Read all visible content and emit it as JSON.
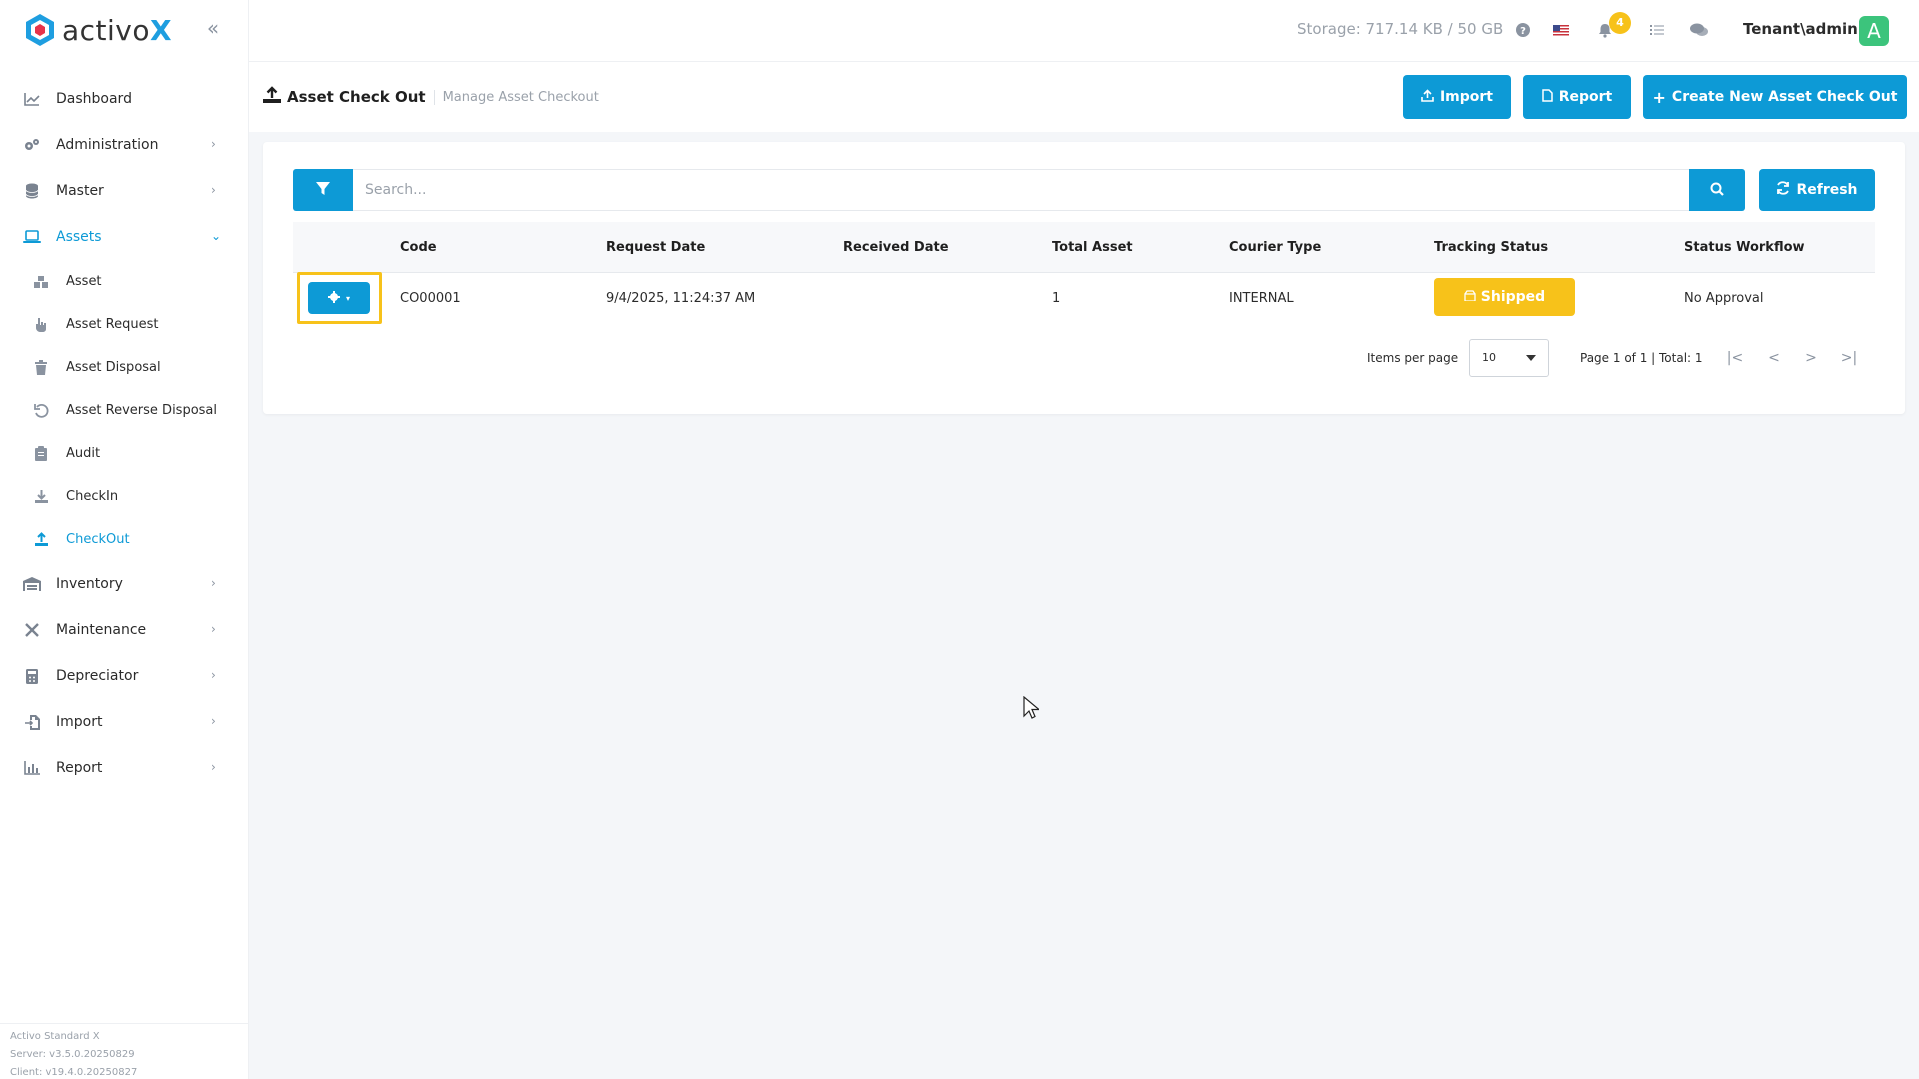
{
  "brand": {
    "name_prefix": "activo",
    "name_suffix": "X"
  },
  "sidebar": {
    "items": [
      {
        "label": "Dashboard",
        "icon": "chart-line-icon",
        "has_chevron": false
      },
      {
        "label": "Administration",
        "icon": "gears-icon",
        "has_chevron": true
      },
      {
        "label": "Master",
        "icon": "database-icon",
        "has_chevron": true
      },
      {
        "label": "Assets",
        "icon": "laptop-icon",
        "has_chevron": true,
        "active": true,
        "expanded": true
      }
    ],
    "asset_subitems": [
      {
        "label": "Asset",
        "icon": "boxes-icon"
      },
      {
        "label": "Asset Request",
        "icon": "hand-pointer-icon"
      },
      {
        "label": "Asset Disposal",
        "icon": "trash-icon"
      },
      {
        "label": "Asset Reverse Disposal",
        "icon": "undo-icon"
      },
      {
        "label": "Audit",
        "icon": "clipboard-icon"
      },
      {
        "label": "CheckIn",
        "icon": "download-icon"
      },
      {
        "label": "CheckOut",
        "icon": "upload-icon",
        "active": true
      }
    ],
    "lower_items": [
      {
        "label": "Inventory",
        "icon": "warehouse-icon",
        "has_chevron": true
      },
      {
        "label": "Maintenance",
        "icon": "tools-icon",
        "has_chevron": true
      },
      {
        "label": "Depreciator",
        "icon": "calculator-icon",
        "has_chevron": true
      },
      {
        "label": "Import",
        "icon": "file-import-icon",
        "has_chevron": true
      },
      {
        "label": "Report",
        "icon": "chart-bar-icon",
        "has_chevron": true
      }
    ],
    "footer": {
      "product": "Activo Standard X",
      "server": "Server: v3.5.0.20250829",
      "client": "Client: v19.4.0.20250827"
    }
  },
  "topbar": {
    "storage": "Storage: 717.14 KB / 50 GB",
    "notification_count": "4",
    "user": "Tenant\\admin",
    "avatar_letter": "A"
  },
  "header": {
    "title": "Asset Check Out",
    "subtitle": "Manage Asset Checkout",
    "import_label": "Import",
    "report_label": "Report",
    "create_label": "Create New Asset Check Out"
  },
  "search": {
    "placeholder": "Search...",
    "refresh_label": "Refresh"
  },
  "table": {
    "columns": [
      "Code",
      "Request Date",
      "Received Date",
      "Total Asset",
      "Courier Type",
      "Tracking Status",
      "Status Workflow"
    ],
    "rows": [
      {
        "code": "CO00001",
        "request_date": "9/4/2025, 11:24:37 AM",
        "received_date": "",
        "total_asset": "1",
        "courier_type": "INTERNAL",
        "tracking_status": "Shipped",
        "status_workflow": "No Approval"
      }
    ]
  },
  "pagination": {
    "items_per_page_label": "Items per page",
    "page_size": "10",
    "page_info": "Page 1 of 1 | Total: 1"
  },
  "colors": {
    "primary": "#0d9ad6",
    "warning": "#f7c21a",
    "avatar": "#3cc47c"
  }
}
